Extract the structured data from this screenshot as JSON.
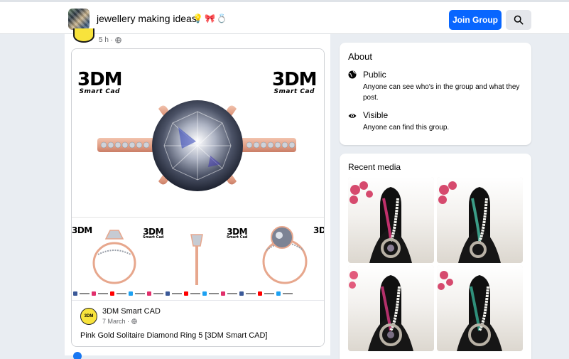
{
  "header": {
    "group_name": "jewellery making ideas",
    "title_emojis": [
      "💡",
      "🎀",
      "💍"
    ],
    "join_label": "Join Group",
    "search_icon": "search-icon"
  },
  "feed": {
    "post_time": "5 h ·",
    "shared_post": {
      "image_logo_big": "3DM",
      "image_logo_small": "Smart Cad",
      "author": "3DM Smart CAD",
      "date": "7 March ·",
      "text": "Pink Gold Solitaire Diamond Ring 5 [3DM Smart CAD]",
      "avatar_text": "3DM"
    }
  },
  "about": {
    "title": "About",
    "items": [
      {
        "icon": "globe-icon",
        "label": "Public",
        "desc": "Anyone can see who's in the group and what they post."
      },
      {
        "icon": "eye-icon",
        "label": "Visible",
        "desc": "Anyone can find this group."
      }
    ]
  },
  "recent_media": {
    "title": "Recent media",
    "items": [
      {
        "bead_color": "#c0306b"
      },
      {
        "bead_color": "#3b9c86"
      },
      {
        "bead_color": "#b3306a"
      },
      {
        "bead_color": "#2f8f7a"
      }
    ]
  },
  "colors": {
    "brand_blue": "#0866ff",
    "rose_gold": "#e7a78d",
    "page_bg": "#e9edf2"
  }
}
